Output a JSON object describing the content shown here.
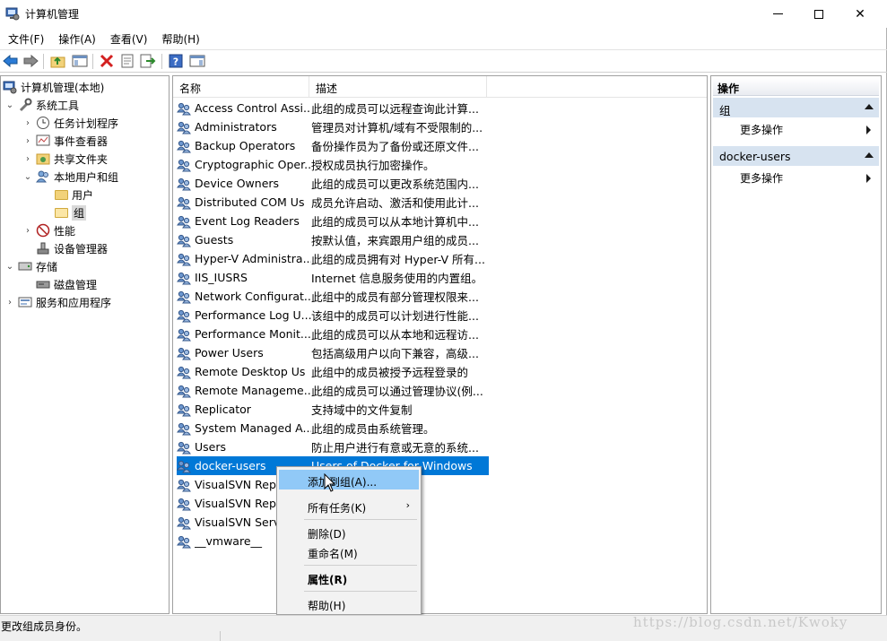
{
  "window": {
    "title": "计算机管理",
    "controls": {
      "minimize": "minimize",
      "maximize": "maximize",
      "close": "✕"
    }
  },
  "menu": [
    "文件(F)",
    "操作(A)",
    "查看(V)",
    "帮助(H)"
  ],
  "toolbar": [
    "back-icon",
    "forward-icon",
    "up-folder-icon",
    "show-hide-tree-icon",
    "delete-icon",
    "properties-icon",
    "export-list-icon",
    "help-icon",
    "show-hide-action-icon"
  ],
  "tree": {
    "root": "计算机管理(本地)",
    "system_tools": "系统工具",
    "task_scheduler": "任务计划程序",
    "event_viewer": "事件查看器",
    "shared_folders": "共享文件夹",
    "local_users_groups": "本地用户和组",
    "users": "用户",
    "groups": "组",
    "performance": "性能",
    "device_manager": "设备管理器",
    "storage": "存储",
    "disk_management": "磁盘管理",
    "services_apps": "服务和应用程序"
  },
  "list": {
    "columns": {
      "name": "名称",
      "desc": "描述"
    },
    "rows": [
      {
        "name": "Access Control Assi...",
        "desc": "此组的成员可以远程查询此计算..."
      },
      {
        "name": "Administrators",
        "desc": "管理员对计算机/域有不受限制的..."
      },
      {
        "name": "Backup Operators",
        "desc": "备份操作员为了备份或还原文件..."
      },
      {
        "name": "Cryptographic Oper...",
        "desc": "授权成员执行加密操作。"
      },
      {
        "name": "Device Owners",
        "desc": "此组的成员可以更改系统范围内..."
      },
      {
        "name": "Distributed COM Us",
        "desc": "成员允许启动、激活和使用此计..."
      },
      {
        "name": "Event Log Readers",
        "desc": "此组的成员可以从本地计算机中..."
      },
      {
        "name": "Guests",
        "desc": "按默认值，来宾跟用户组的成员..."
      },
      {
        "name": "Hyper-V Administra...",
        "desc": "此组的成员拥有对 Hyper-V 所有..."
      },
      {
        "name": "IIS_IUSRS",
        "desc": "Internet 信息服务使用的内置组。"
      },
      {
        "name": "Network Configurat...",
        "desc": "此组中的成员有部分管理权限来..."
      },
      {
        "name": "Performance Log U...",
        "desc": "该组中的成员可以计划进行性能..."
      },
      {
        "name": "Performance Monit...",
        "desc": "此组的成员可以从本地和远程访..."
      },
      {
        "name": "Power Users",
        "desc": "包括高级用户以向下兼容，高级..."
      },
      {
        "name": "Remote Desktop Us",
        "desc": "此组中的成员被授予远程登录的"
      },
      {
        "name": "Remote Manageme...",
        "desc": "此组的成员可以通过管理协议(例..."
      },
      {
        "name": "Replicator",
        "desc": "支持域中的文件复制"
      },
      {
        "name": "System Managed A...",
        "desc": "此组的成员由系统管理。"
      },
      {
        "name": "Users",
        "desc": "防止用户进行有意或无意的系统..."
      },
      {
        "name": "docker-users",
        "desc": "Users of Docker for Windows",
        "selected": true
      },
      {
        "name": "VisualSVN Repli",
        "desc": "s in this g..."
      },
      {
        "name": "VisualSVN Repo",
        "desc": "up can m..."
      },
      {
        "name": "VisualSVN Serve",
        "desc": "up have f..."
      },
      {
        "name": "__vmware__",
        "desc": ""
      }
    ]
  },
  "actions": {
    "header": "操作",
    "sections": [
      {
        "title": "组",
        "item": "更多操作"
      },
      {
        "title": "docker-users",
        "item": "更多操作"
      }
    ]
  },
  "context_menu": {
    "add_to_group": "添加到组(A)...",
    "all_tasks": "所有任务(K)",
    "submenu_arrow": "›",
    "delete": "删除(D)",
    "rename": "重命名(M)",
    "properties": "属性(R)",
    "help": "帮助(H)"
  },
  "status": "更改组成员身份。",
  "watermark": "https://blog.csdn.net/Kwoky"
}
